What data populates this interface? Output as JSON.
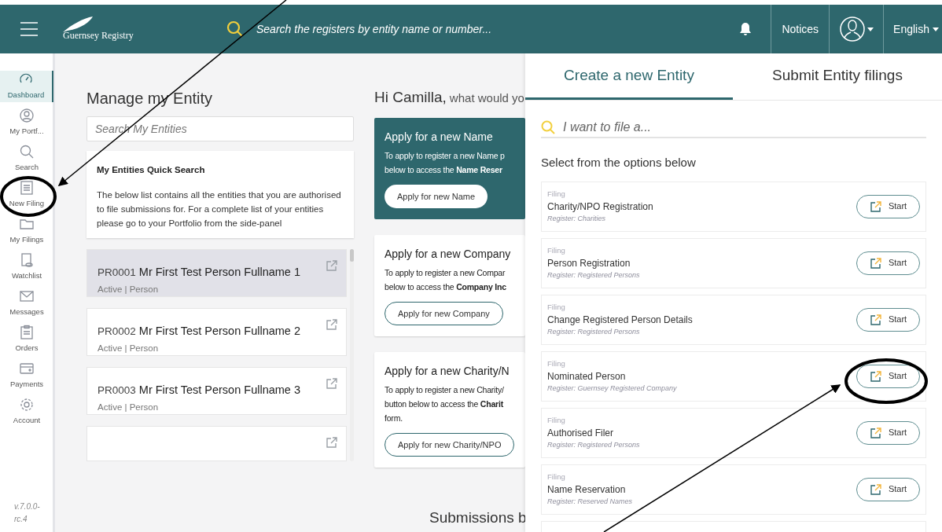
{
  "header": {
    "logo": "Guernsey Registry",
    "search_placeholder": "Search the registers by entity name or number...",
    "notices": "Notices",
    "language": "English"
  },
  "sidebar": {
    "items": [
      {
        "label": "Dashboard",
        "selected": true
      },
      {
        "label": "My Portf...",
        "selected": false
      },
      {
        "label": "Search",
        "selected": false
      },
      {
        "label": "New Filing",
        "selected": false
      },
      {
        "label": "My Filings",
        "selected": false
      },
      {
        "label": "Watchlist",
        "selected": false
      },
      {
        "label": "Messages",
        "selected": false
      },
      {
        "label": "Orders",
        "selected": false
      },
      {
        "label": "Payments",
        "selected": false
      },
      {
        "label": "Account",
        "selected": false
      }
    ],
    "version": [
      "v.7.0.0-",
      "rc.4"
    ]
  },
  "manage": {
    "title": "Manage my Entity",
    "search_placeholder": "Search My Entities",
    "quick_title": "My Entities Quick Search",
    "quick_text": "The below list contains all the entities that you are authorised to file submissions for. For a complete list of your entities please go to your Portfolio from the side-panel",
    "entities": [
      {
        "code": "PR0001",
        "name": "Mr First Test Person Fullname 1",
        "meta": "Active | Person",
        "selected": true
      },
      {
        "code": "PR0002",
        "name": "Mr First Test Person Fullname 2",
        "meta": "Active | Person",
        "selected": false
      },
      {
        "code": "PR0003",
        "name": "Mr First Test Person Fullname 3",
        "meta": "Active | Person",
        "selected": false
      }
    ]
  },
  "greeting": {
    "name": "Hi Camilla,",
    "rest": "what would yo"
  },
  "apply_cards": [
    {
      "title": "Apply for a new Name",
      "lines": [
        "To apply to register a new Name p",
        "below to access the **Name Reser**"
      ],
      "button": "Apply for new Name",
      "highlighted": true
    },
    {
      "title": "Apply for a new Company",
      "lines": [
        "To apply to register a new Compar",
        "below to access the **Company Inc**"
      ],
      "button": "Apply for new Company",
      "highlighted": false
    },
    {
      "title": "Apply for a new Charity/N",
      "lines": [
        "To apply to register a new Charity/",
        "button below to access the **Charit**",
        "form."
      ],
      "button": "Apply for new Charity/NPO",
      "highlighted": false
    }
  ],
  "submissions_heading": "Submissions b",
  "panel": {
    "tabs": [
      {
        "label": "Create a new Entity",
        "selected": true
      },
      {
        "label": "Submit Entity filings",
        "selected": false
      }
    ],
    "search_placeholder": "I want to file a...",
    "subtitle": "Select from the options below",
    "options": [
      {
        "kind_label": "Filing",
        "title": "Charity/NPO Registration",
        "register": "Register: Charities",
        "button": "Start"
      },
      {
        "kind_label": "Filing",
        "title": "Person Registration",
        "register": "Register: Registered Persons",
        "button": "Start"
      },
      {
        "kind_label": "Filing",
        "title": "Change Registered Person Details",
        "register": "Register: Registered Persons",
        "button": "Start"
      },
      {
        "kind_label": "Filing",
        "title": "Nominated Person",
        "register": "Register: Guernsey Registered Company",
        "button": "Start"
      },
      {
        "kind_label": "Filing",
        "title": "Authorised Filer",
        "register": "Register: Registered Persons",
        "button": "Start"
      },
      {
        "kind_label": "Filing",
        "title": "Name Reservation",
        "register": "Register: Reserved Names",
        "button": "Start"
      }
    ]
  }
}
